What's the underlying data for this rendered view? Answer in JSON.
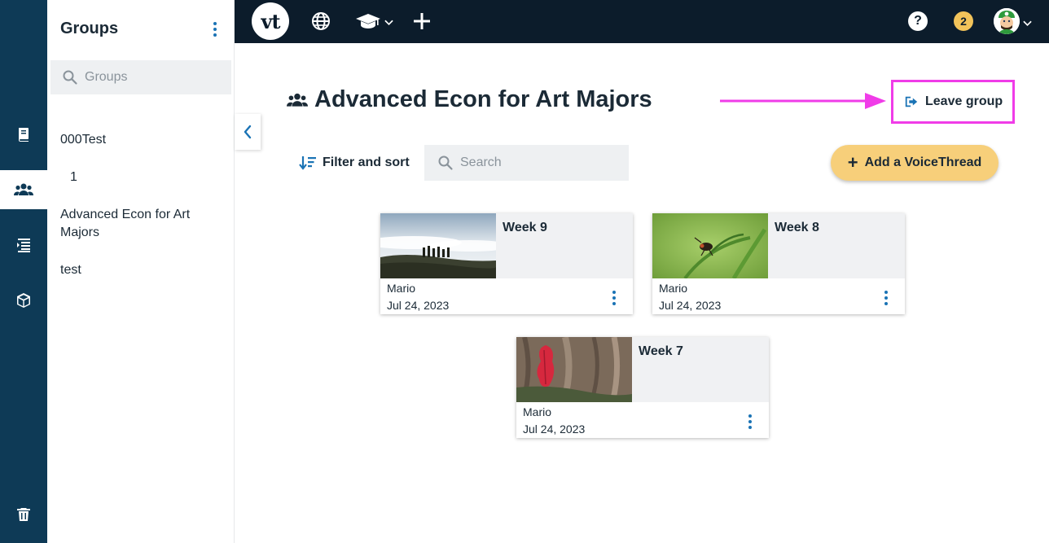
{
  "sidebar_rail": {
    "items": [
      {
        "name": "library",
        "icon": "book-icon"
      },
      {
        "name": "groups",
        "icon": "users-icon",
        "active": true
      },
      {
        "name": "courses",
        "icon": "list-icon"
      },
      {
        "name": "items",
        "icon": "box-icon"
      },
      {
        "name": "trash",
        "icon": "trash-icon"
      }
    ]
  },
  "groups_panel": {
    "title": "Groups",
    "search_placeholder": "Groups",
    "items": [
      "000Test",
      "1",
      "Advanced Econ for Art Majors",
      "test"
    ]
  },
  "topbar": {
    "logo_text": "vt",
    "help_label": "?",
    "notification_count": "2"
  },
  "page": {
    "title": "Advanced Econ for Art Majors",
    "leave_label": "Leave group",
    "filter_label": "Filter and sort",
    "search_placeholder": "Search",
    "add_label": "Add a VoiceThread"
  },
  "cards": [
    {
      "title": "Week 9",
      "owner": "Mario",
      "date": "Jul 24, 2023"
    },
    {
      "title": "Week 8",
      "owner": "Mario",
      "date": "Jul 24, 2023"
    },
    {
      "title": "Week 7",
      "owner": "Mario",
      "date": "Jul 24, 2023"
    }
  ],
  "colors": {
    "rail": "#0e3a56",
    "topbar": "#0c1c2b",
    "accent": "#1a73b5",
    "add_button": "#f7cf7a",
    "notification_badge": "#f2c35a",
    "annotation": "#f03ce8"
  }
}
